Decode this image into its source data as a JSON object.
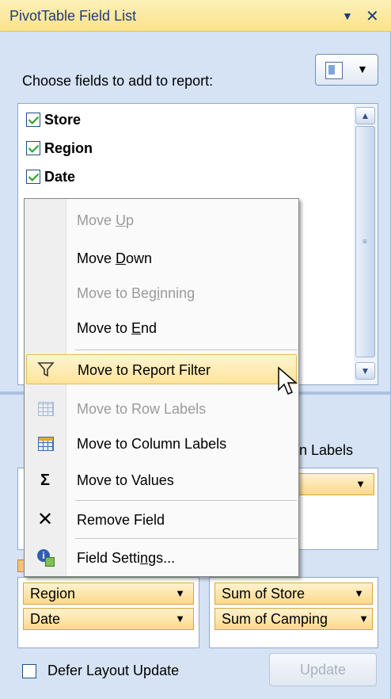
{
  "panel": {
    "title": "PivotTable Field List",
    "title_menu_icon": "triangle-down-icon",
    "close_icon": "close-icon",
    "choose_label": "Choose fields to add to report:",
    "layout_button_icon": "field-list-layout-icon"
  },
  "fields": [
    {
      "label": "Store",
      "checked": true
    },
    {
      "label": "Region",
      "checked": true
    },
    {
      "label": "Date",
      "checked": true
    }
  ],
  "areas": {
    "column_labels_partial": "n Labels",
    "row_labels": [
      "Region",
      "Date"
    ],
    "values": [
      "Sum of Store",
      "Sum of Camping"
    ]
  },
  "footer": {
    "defer_label": "Defer Layout Update",
    "update_label": "Update"
  },
  "context_menu": {
    "items": [
      {
        "pre": "Move ",
        "key": "U",
        "post": "p",
        "disabled": true
      },
      {
        "pre": "Move ",
        "key": "D",
        "post": "own",
        "disabled": false
      },
      {
        "pre": "Move to Beg",
        "key": "i",
        "post": "nning",
        "disabled": true
      },
      {
        "pre": "Move to ",
        "key": "E",
        "post": "nd",
        "disabled": false
      },
      {
        "label": "Move to Report Filter",
        "icon": "filter-icon",
        "highlighted": true
      },
      {
        "label": "Move to Row Labels",
        "icon": "row-labels-icon",
        "disabled": true
      },
      {
        "label": "Move to Column Labels",
        "icon": "column-labels-icon"
      },
      {
        "label": "Move to Values",
        "icon": "sigma-icon"
      },
      {
        "label": "Remove Field",
        "icon": "x-icon"
      },
      {
        "pre": "Field Setti",
        "key": "n",
        "post": "gs...",
        "icon": "field-settings-icon"
      }
    ]
  }
}
